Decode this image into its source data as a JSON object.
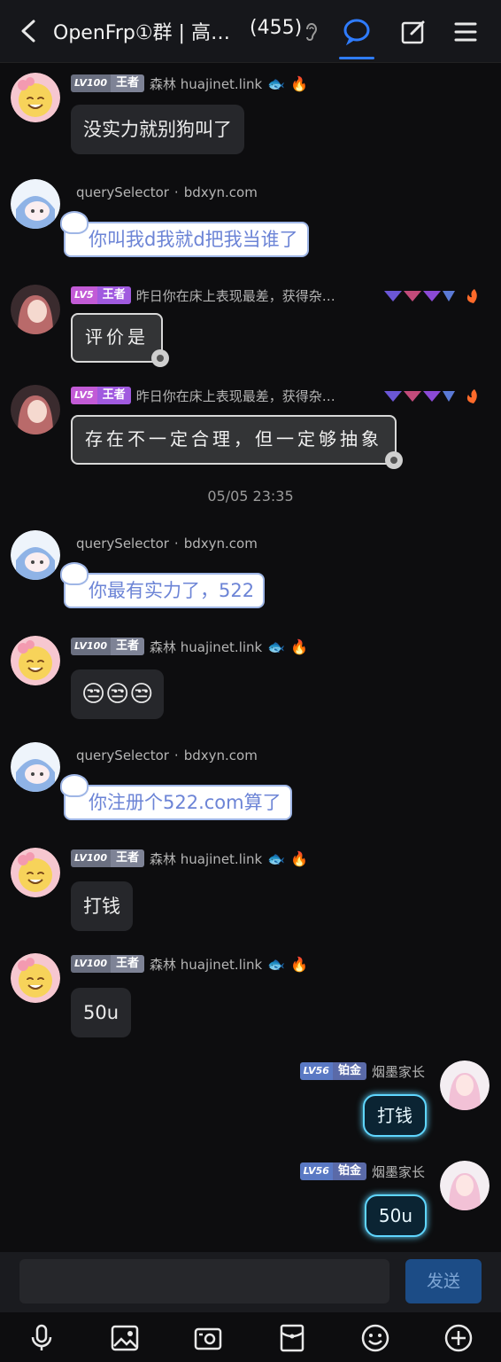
{
  "header": {
    "title": "OpenFrp①群 | 高…",
    "member_count": "(455)",
    "active_tab_color": "#2f7cff"
  },
  "messages": [
    {
      "sender": "森林 huajinet.link",
      "badge_level": "LV100",
      "badge_rank": "王者",
      "text": "没实力就别狗叫了"
    },
    {
      "sender": "querySelector",
      "sender_domain": "bdxyn.com",
      "text": "你叫我d我就d把我当谁了"
    },
    {
      "sender": "昨日你在床上表现最差，获得杂…",
      "badge_level": "LV5",
      "badge_rank": "王者",
      "text": "评价是"
    },
    {
      "sender": "昨日你在床上表现最差，获得杂…",
      "badge_level": "LV5",
      "badge_rank": "王者",
      "text": "存在不一定合理，但一定够抽象"
    },
    {
      "sender": "querySelector",
      "sender_domain": "bdxyn.com",
      "text": "你最有实力了，522"
    },
    {
      "sender": "森林 huajinet.link",
      "badge_level": "LV100",
      "badge_rank": "王者",
      "text": "😒😒😒"
    },
    {
      "sender": "querySelector",
      "sender_domain": "bdxyn.com",
      "text": "你注册个522.com算了"
    },
    {
      "sender": "森林 huajinet.link",
      "badge_level": "LV100",
      "badge_rank": "王者",
      "text": "打钱"
    },
    {
      "sender": "森林 huajinet.link",
      "badge_level": "LV100",
      "badge_rank": "王者",
      "text": "50u"
    },
    {
      "sender": "烟墨家长",
      "badge_level": "LV56",
      "badge_rank": "铂金",
      "text": "打钱"
    },
    {
      "sender": "烟墨家长",
      "badge_level": "LV56",
      "badge_rank": "铂金",
      "text": "50u"
    }
  ],
  "separator": "·",
  "timestamp": "05/05 23:35",
  "input": {
    "placeholder": "",
    "send_label": "发送"
  },
  "toolbar": [
    "microphone-icon",
    "image-icon",
    "camera-icon",
    "red-packet-icon",
    "emoji-icon",
    "plus-icon"
  ]
}
